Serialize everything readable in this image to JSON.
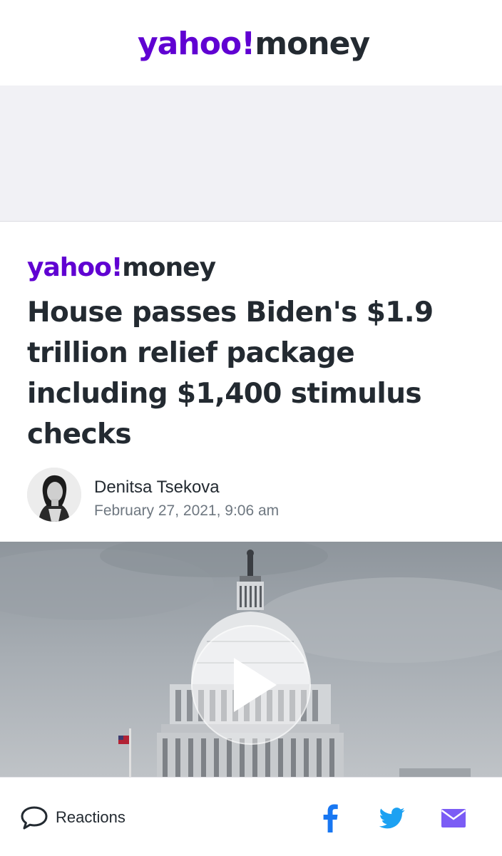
{
  "header": {
    "logo_brand": "yahoo!",
    "logo_product": "money"
  },
  "article": {
    "publisher_brand": "yahoo!",
    "publisher_product": "money",
    "headline": "House passes Biden's $1.9 trillion relief package including $1,400 stimulus checks",
    "author": "Denitsa Tsekova",
    "date": "February 27, 2021, 9:06 am"
  },
  "media": {
    "type": "video",
    "play_icon": "play-icon"
  },
  "footer": {
    "reactions_label": "Reactions",
    "reactions_icon": "speech-bubble-icon",
    "share_icons": [
      "facebook-icon",
      "twitter-icon",
      "mail-icon"
    ]
  },
  "colors": {
    "brand_purple": "#6001d2",
    "headline_text": "#232a31",
    "meta_text": "#6e7780",
    "facebook_blue": "#1877f2",
    "twitter_blue": "#1da1f2",
    "mail_purple": "#7b5cf5"
  }
}
